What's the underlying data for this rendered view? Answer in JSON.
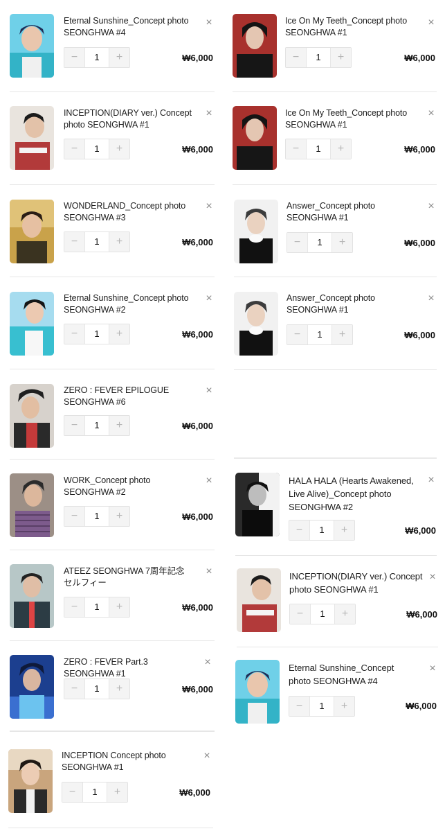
{
  "items": [
    {
      "title": "Eternal Sunshine_Concept photo SEONGHWA #4",
      "qty": "1",
      "price": "₩6,000"
    },
    {
      "title": "Ice On My Teeth_Concept photo SEONGHWA #1",
      "qty": "1",
      "price": "₩6,000"
    },
    {
      "title": "INCEPTION(DIARY ver.) Concept photo SEONGHWA #1",
      "qty": "1",
      "price": "₩6,000"
    },
    {
      "title": "Ice On My Teeth_Concept photo SEONGHWA #1",
      "qty": "1",
      "price": "₩6,000"
    },
    {
      "title": "WONDERLAND_Concept photo SEONGHWA #3",
      "qty": "1",
      "price": "₩6,000"
    },
    {
      "title": "Answer_Concept photo SEONGHWA #1",
      "qty": "1",
      "price": "₩6,000"
    },
    {
      "title": "Eternal Sunshine_Concept photo SEONGHWA #2",
      "qty": "1",
      "price": "₩6,000"
    },
    {
      "title": "Answer_Concept photo SEONGHWA #1",
      "qty": "1",
      "price": "₩6,000"
    },
    {
      "title": "ZERO : FEVER EPILOGUE SEONGHWA #6",
      "qty": "1",
      "price": "₩6,000"
    },
    {
      "title": "WORK_Concept photo SEONGHWA #2",
      "qty": "1",
      "price": "₩6,000"
    },
    {
      "title": "HALA HALA (Hearts Awakened, Live Alive)_Concept photo SEONGHWA #2",
      "qty": "1",
      "price": "₩6,000"
    },
    {
      "title": "ATEEZ SEONGHWA 7周年記念セルフィー",
      "qty": "1",
      "price": "₩6,000"
    },
    {
      "title": "INCEPTION(DIARY ver.) Concept photo SEONGHWA #1",
      "qty": "1",
      "price": "₩6,000"
    },
    {
      "title": "ZERO : FEVER Part.3 SEONGHWA #1",
      "qty": "1",
      "price": "₩6,000"
    },
    {
      "title": "Eternal Sunshine_Concept photo SEONGHWA #4",
      "qty": "1",
      "price": "₩6,000"
    },
    {
      "title": "INCEPTION Concept photo SEONGHWA #1",
      "qty": "1",
      "price": "₩6,000"
    }
  ],
  "controls": {
    "minus": "−",
    "plus": "+",
    "close": "×"
  },
  "colors": {
    "accent": "#1a1a1a",
    "divider": "#e6e6e6",
    "stepper_bg": "#f4f4f4"
  }
}
